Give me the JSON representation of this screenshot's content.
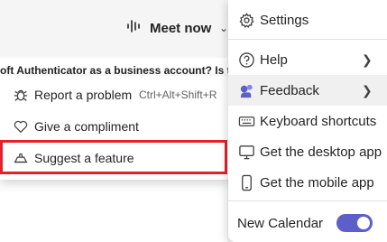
{
  "topbar": {
    "meet_now_label": "Meet now",
    "meet_now_icon": "waveform-icon",
    "background_text": "oft Authenticator as a business account? Is the"
  },
  "feedback_submenu": {
    "items": [
      {
        "label": "Report a problem",
        "shortcut": "Ctrl+Alt+Shift+R",
        "icon": "bug-icon"
      },
      {
        "label": "Give a compliment",
        "icon": "heart-icon"
      },
      {
        "label": "Suggest a feature",
        "icon": "lightbulb-icon",
        "highlighted": true
      }
    ],
    "highlight_color": "#e3202b"
  },
  "settings_menu": {
    "items": [
      {
        "label": "Settings",
        "icon": "gear-icon"
      },
      {
        "label": "Help",
        "icon": "question-icon",
        "has_submenu": true
      },
      {
        "label": "Feedback",
        "icon": "feedback-icon",
        "has_submenu": true,
        "active": true
      },
      {
        "label": "Keyboard shortcuts",
        "icon": "keyboard-icon"
      },
      {
        "label": "Get the desktop app",
        "icon": "monitor-icon"
      },
      {
        "label": "Get the mobile app",
        "icon": "phone-icon"
      }
    ],
    "new_calendar": {
      "label": "New Calendar",
      "enabled": true,
      "accent": "#5b5fc7"
    }
  }
}
